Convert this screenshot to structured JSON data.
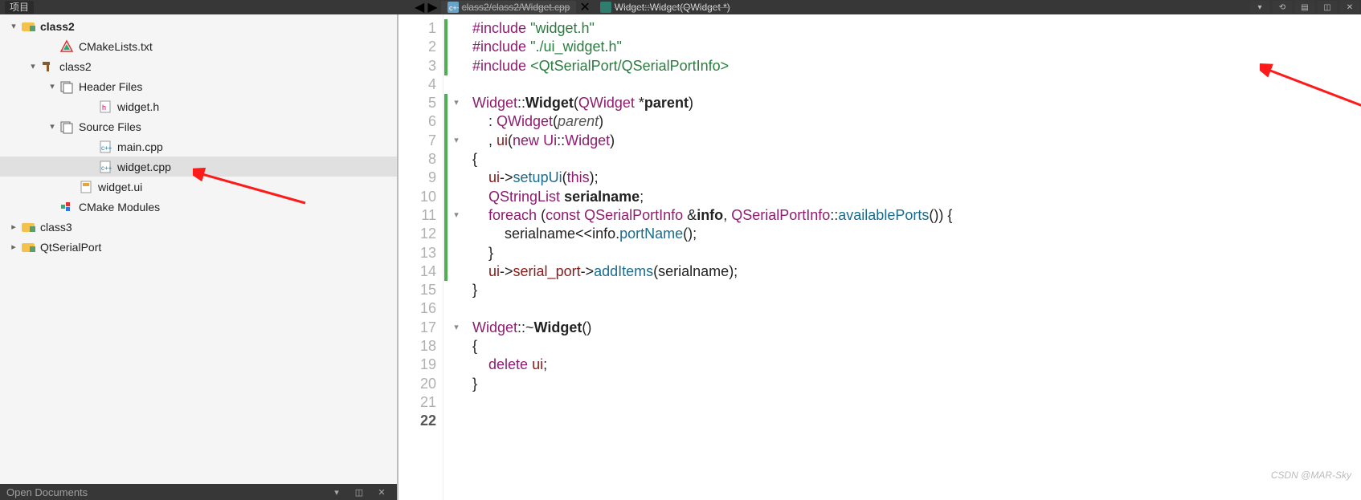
{
  "top": {
    "panel_label": "项目",
    "active_tab": "class2/class2/Widget.cpp",
    "side_tab": "Widget::Widget(QWidget *)"
  },
  "tree": {
    "root": {
      "label": "class2"
    },
    "items": [
      {
        "label": "CMakeLists.txt"
      },
      {
        "label": "class2"
      },
      {
        "label": "Header Files"
      },
      {
        "label": "widget.h"
      },
      {
        "label": "Source Files"
      },
      {
        "label": "main.cpp"
      },
      {
        "label": "widget.cpp"
      },
      {
        "label": "widget.ui"
      },
      {
        "label": "CMake Modules"
      },
      {
        "label": "class3"
      },
      {
        "label": "QtSerialPort"
      }
    ]
  },
  "bottom": {
    "label": "Open Documents"
  },
  "code": {
    "lines": [
      {
        "n": "1",
        "raw": "#include \"widget.h\"",
        "kind": "inc",
        "q": "\"widget.h\"",
        "changed": true
      },
      {
        "n": "2",
        "raw": "#include \"./ui_widget.h\"",
        "kind": "inc",
        "q": "\"./ui_widget.h\"",
        "changed": true
      },
      {
        "n": "3",
        "raw": "#include <QtSerialPort/QSerialPortInfo>",
        "kind": "inc",
        "q": "<QtSerialPort/QSerialPortInfo>",
        "changed": true
      },
      {
        "n": "4",
        "raw": "",
        "kind": "blank"
      },
      {
        "n": "5",
        "raw": "Widget::Widget(QWidget *parent)",
        "kind": "code",
        "changed": true,
        "fold": "down"
      },
      {
        "n": "6",
        "raw": "    : QWidget(parent)",
        "kind": "code",
        "changed": true
      },
      {
        "n": "7",
        "raw": "    , ui(new Ui::Widget)",
        "kind": "code",
        "changed": true,
        "fold": "down"
      },
      {
        "n": "8",
        "raw": "{",
        "kind": "code",
        "changed": true
      },
      {
        "n": "9",
        "raw": "    ui->setupUi(this);",
        "kind": "code",
        "changed": true
      },
      {
        "n": "10",
        "raw": "    QStringList serialname;",
        "kind": "code",
        "changed": true
      },
      {
        "n": "11",
        "raw": "    foreach (const QSerialPortInfo &info, QSerialPortInfo::availablePorts()) {",
        "kind": "code",
        "changed": true,
        "fold": "down"
      },
      {
        "n": "12",
        "raw": "        serialname<<info.portName();",
        "kind": "code",
        "changed": true
      },
      {
        "n": "13",
        "raw": "    }",
        "kind": "code",
        "changed": true
      },
      {
        "n": "14",
        "raw": "    ui->serial_port->addItems(serialname);",
        "kind": "code",
        "changed": true
      },
      {
        "n": "15",
        "raw": "}",
        "kind": "code"
      },
      {
        "n": "16",
        "raw": "",
        "kind": "blank"
      },
      {
        "n": "17",
        "raw": "Widget::~Widget()",
        "kind": "code",
        "fold": "down"
      },
      {
        "n": "18",
        "raw": "{",
        "kind": "code"
      },
      {
        "n": "19",
        "raw": "    delete ui;",
        "kind": "code"
      },
      {
        "n": "20",
        "raw": "}",
        "kind": "code"
      },
      {
        "n": "21",
        "raw": "",
        "kind": "blank"
      },
      {
        "n": "22",
        "raw": "",
        "kind": "blank",
        "bold": true
      }
    ]
  },
  "watermark": "CSDN @MAR-Sky"
}
